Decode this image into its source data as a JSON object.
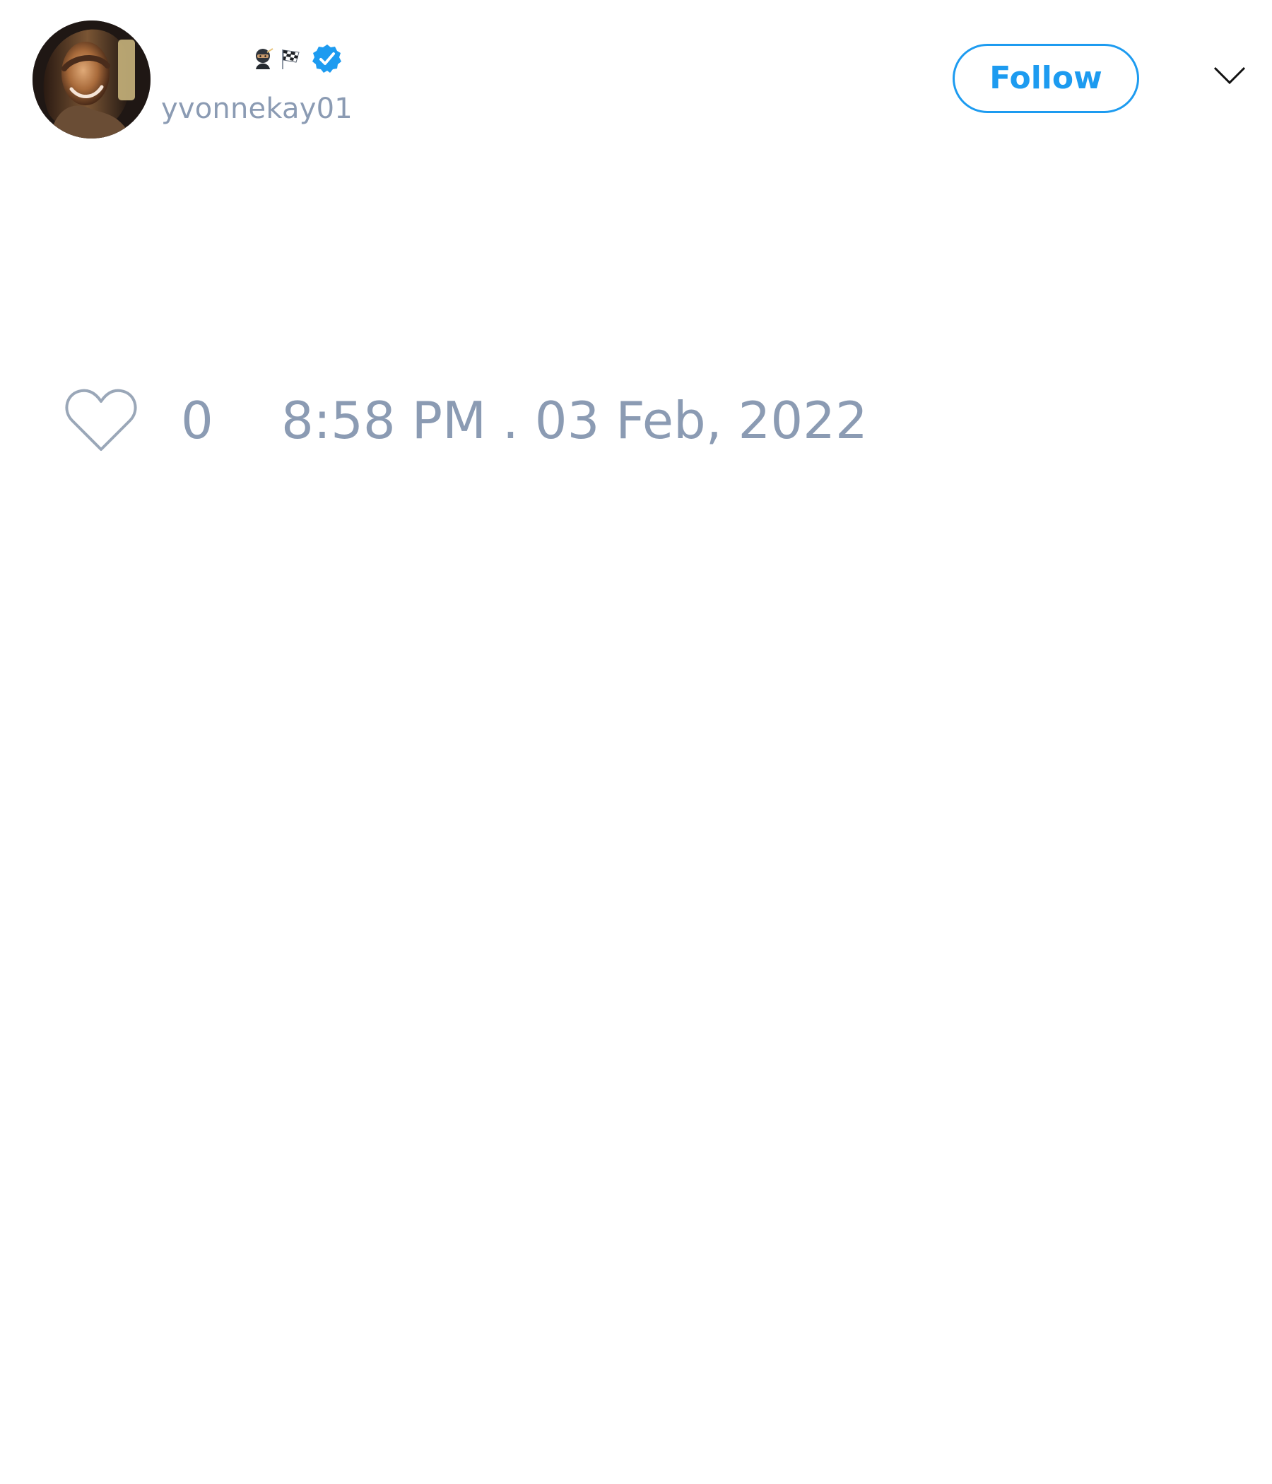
{
  "user": {
    "handle": "yvonnekay01",
    "name_emoji": [
      "ninja-emoji",
      "checkered-flag-emoji"
    ],
    "verified": true
  },
  "actions": {
    "follow_label": "Follow",
    "menu_icon": "chevron-down-icon"
  },
  "stats": {
    "like_icon": "heart-outline-icon",
    "like_count": "0",
    "timestamp": "8:58 PM . 03 Feb, 2022"
  },
  "colors": {
    "accent": "#1d9bf0",
    "muted_text": "#8b9bb3",
    "icon_gray": "#9aa7b8",
    "background": "#ffffff"
  }
}
